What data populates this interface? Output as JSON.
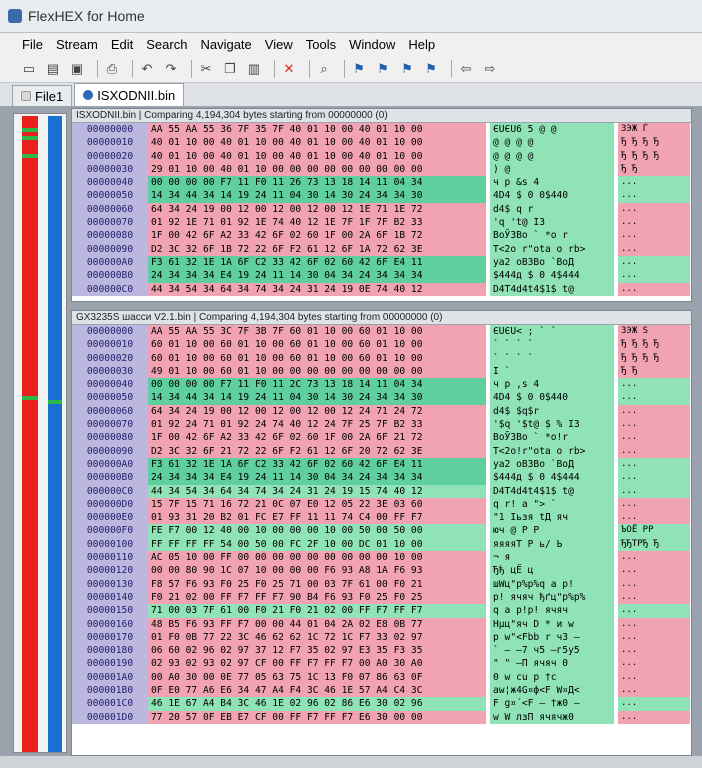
{
  "window_title": "FlexHEX for Home",
  "menu": [
    "File",
    "Stream",
    "Edit",
    "Search",
    "Navigate",
    "View",
    "Tools",
    "Window",
    "Help"
  ],
  "tabs": [
    {
      "label": "File1"
    },
    {
      "label": "ISXODNII.bin"
    }
  ],
  "pane_a": {
    "header": "ISXODNII.bin | Comparing 4,194,304 bytes starting from 00000000 (0)",
    "rows": [
      {
        "addr": "00000000",
        "hex": "AA 55 AA 55 36 7F 35 7F 40 01 10 00 40 01 10 00",
        "txt": "ЄUЄU6 5 @ @",
        "cyr": "ЗЭЖ Ѓ"
      },
      {
        "addr": "00000010",
        "hex": "40 01 10 00 40 01 10 00 40 01 10 00 40 01 10 00",
        "txt": "@ @ @ @",
        "cyr": "Ђ Ђ Ђ Ђ"
      },
      {
        "addr": "00000020",
        "hex": "40 01 10 00 40 01 10 00 40 01 10 00 40 01 10 00",
        "txt": "@ @ @ @",
        "cyr": "Ђ Ђ Ђ Ђ"
      },
      {
        "addr": "00000030",
        "hex": "29 01 10 00 40 01 10 00 00 00 00 00 00 00 00 00",
        "txt": ") @",
        "cyr": "Ђ Ђ"
      },
      {
        "addr": "00000040",
        "hex": "00 00 00 00 F7 11 F0 11 26 73 13 18 14 11 04 34",
        "txt": "ч р &s 4",
        "cyr": "..."
      },
      {
        "addr": "00000050",
        "hex": "14 34 44 34 14 19 24 11 04 30 14 30 24 34 34 30",
        "txt": "4D4 $ 0 0$440",
        "cyr": "..."
      },
      {
        "addr": "00000060",
        "hex": "64 34 24 19 00 12 00 12 00 12 00 12 1E 71 1E 72",
        "txt": "d4$ q r",
        "cyr": "..."
      },
      {
        "addr": "00000070",
        "hex": "01 92 1E 71 01 92 1E 74 40 12 1E 7F 1F 7F B2 33",
        "txt": "'q 't@ I3",
        "cyr": "..."
      },
      {
        "addr": "00000080",
        "hex": "1F 00 42 6F A2 33 42 6F 02 60 1F 00 2A 6F 1B 72",
        "txt": "BoЎ3Bo ` *o r",
        "cyr": "..."
      },
      {
        "addr": "00000090",
        "hex": "D2 3C 32 6F 1B 72 22 6F F2 61 12 6F 1A 72 62 3E",
        "txt": "Т<2o r\"ota o rb>",
        "cyr": "..."
      },
      {
        "addr": "000000A0",
        "hex": "F3 61 32 1E 1A 6F C2 33 42 6F 02 60 42 6F E4 11",
        "txt": "уa2 oВ3Bo `BoД",
        "cyr": "..."
      },
      {
        "addr": "000000B0",
        "hex": "24 34 34 34 E4 19 24 11 14 30 04 34 24 34 34 34",
        "txt": "$444д $ 0 4$444",
        "cyr": "..."
      },
      {
        "addr": "000000C0",
        "hex": "44 34 54 34 64 34 74 34 24 31 24 19 0E 74 40 12",
        "txt": "D4T4d4t4$1$ t@",
        "cyr": "..."
      }
    ]
  },
  "pane_b": {
    "header": "GX3235S шасси V2.1.bin | Comparing 4,194,304 bytes starting from 00000000 (0)",
    "rows": [
      {
        "addr": "00000000",
        "hex": "AA 55 AA 55 3C 7F 3B 7F 60 01 10 00 60 01 10 00",
        "txt": "ЄUЄU< ; ` `",
        "cyr": "ЗЭЖ Ѕ"
      },
      {
        "addr": "00000010",
        "hex": "60 01 10 00 60 01 10 00 60 01 10 00 60 01 10 00",
        "txt": "` ` ` `",
        "cyr": "Ђ Ђ Ђ Ђ"
      },
      {
        "addr": "00000020",
        "hex": "60 01 10 00 60 01 10 00 60 01 10 00 60 01 10 00",
        "txt": "` ` ` `",
        "cyr": "Ђ Ђ Ђ Ђ"
      },
      {
        "addr": "00000030",
        "hex": "49 01 10 00 60 01 10 00 00 00 00 00 00 00 00 00",
        "txt": "I `",
        "cyr": "Ђ Ђ"
      },
      {
        "addr": "00000040",
        "hex": "00 00 00 00 F7 11 F0 11 2C 73 13 18 14 11 04 34",
        "txt": "ч р ,s 4",
        "cyr": "..."
      },
      {
        "addr": "00000050",
        "hex": "14 34 44 34 14 19 24 11 04 30 14 30 24 34 34 30",
        "txt": "4D4 $ 0 0$440",
        "cyr": "..."
      },
      {
        "addr": "00000060",
        "hex": "64 34 24 19 00 12 00 12 00 12 00 12 24 71 24 72",
        "txt": "d4$ $q$r",
        "cyr": "..."
      },
      {
        "addr": "00000070",
        "hex": "01 92 24 71 01 92 24 74 40 12 24 7F 25 7F B2 33",
        "txt": "'$q '$t@ $ % I3",
        "cyr": "..."
      },
      {
        "addr": "00000080",
        "hex": "1F 00 42 6F A2 33 42 6F 02 60 1F 00 2A 6F 21 72",
        "txt": "BoЎ3Bo ` *o!r",
        "cyr": "..."
      },
      {
        "addr": "00000090",
        "hex": "D2 3C 32 6F 21 72 22 6F F2 61 12 6F 20 72 62 3E",
        "txt": "Т<2o!r\"ota o rb>",
        "cyr": "..."
      },
      {
        "addr": "000000A0",
        "hex": "F3 61 32 1E 1A 6F C2 33 42 6F 02 60 42 6F E4 11",
        "txt": "уa2 oВ3Bo `BoД",
        "cyr": "..."
      },
      {
        "addr": "000000B0",
        "hex": "24 34 34 34 E4 19 24 11 14 30 04 34 24 34 34 34",
        "txt": "$444д $ 0 4$444",
        "cyr": "..."
      },
      {
        "addr": "000000C0",
        "hex": "44 34 54 34 64 34 74 34 24 31 24 19 15 74 40 12",
        "txt": "D4T4d4t4$1$ t@",
        "cyr": "..."
      },
      {
        "addr": "000000D0",
        "hex": "15 7F 15 71 16 72 21 0C 07 E0 12 05 22 3E 03 60",
        "txt": "q r! а \"> `",
        "cyr": "..."
      },
      {
        "addr": "000000E0",
        "hex": "01 93 31 20 B2 01 FC E7 FF 11 11 74 C4 00 FF F7",
        "txt": "\"1 Iьзя tД яч",
        "cyr": "..."
      },
      {
        "addr": "000000F0",
        "hex": "FE F7 00 12 40 00 10 00 00 00 10 00 50 00 50 00",
        "txt": "юч @ P P",
        "cyr": "ЪОЁ РР"
      },
      {
        "addr": "00000100",
        "hex": "FF FF FF FF 54 00 50 00 FC 2F 10 00 DC 01 10 00",
        "txt": "яяяяT P ь/ Ь",
        "cyr": "ЂЂТРЂ Ђ"
      },
      {
        "addr": "00000110",
        "hex": "AC 05 10 00 FF 00 00 00 00 00 00 00 00 00 10 00",
        "txt": "¬ я",
        "cyr": "..."
      },
      {
        "addr": "00000120",
        "hex": "00 00 80 90 1C 07 10 00 00 00 F6 93 A8 1A F6 93",
        "txt": "Ђђ цЁ ц",
        "cyr": "..."
      },
      {
        "addr": "00000130",
        "hex": "F8 57 F6 93 F0 25 F0 25 71 00 03 7F 61 00 F0 21",
        "txt": "шWц\"р%р%q a р!",
        "cyr": "..."
      },
      {
        "addr": "00000140",
        "hex": "F0 21 02 00 FF F7 FF F7 90 B4 F6 93 F0 25 F0 25",
        "txt": "р! ячяч ђґц\"р%р%",
        "cyr": "..."
      },
      {
        "addr": "00000150",
        "hex": "71 00 03 7F 61 00 F0 21 F0 21 02 00 FF F7 FF F7",
        "txt": "q a р!р! ячяч",
        "cyr": "..."
      },
      {
        "addr": "00000160",
        "hex": "48 B5 F6 93 FF F7 00 00 44 01 04 2A 02 E8 0B 77",
        "txt": "Hµц\"яч D * и w",
        "cyr": "..."
      },
      {
        "addr": "00000170",
        "hex": "01 F0 0B 77 22 3C 46 62 62 1C 72 1C F7 33 02 97",
        "txt": "р w\"<Fbb r ч3 —",
        "cyr": "..."
      },
      {
        "addr": "00000180",
        "hex": "06 60 02 96 02 97 37 12 F7 35 02 97 E3 35 F3 35",
        "txt": "` – —7 ч5 —г5у5",
        "cyr": "..."
      },
      {
        "addr": "00000190",
        "hex": "02 93 02 93 02 97 CF 00 FF F7 FF F7 00 A0 30 A0",
        "txt": "\" \" —П ячяч 0",
        "cyr": "..."
      },
      {
        "addr": "000001A0",
        "hex": "00 A0 30 00 0E 77 05 63 75 1C 13 F0 07 86 63 0F",
        "txt": "0 w cu р †c",
        "cyr": "..."
      },
      {
        "addr": "000001B0",
        "hex": "0F E0 77 A6 E6 34 47 A4 F4 3C 46 1E 57 A4 C4 3C",
        "txt": "аw¦ж4G¤ф<F W¤Д<",
        "cyr": "..."
      },
      {
        "addr": "000001C0",
        "hex": "46 1E 67 A4 B4 3C 46 1E 02 96 02 86 E6 30 02 96",
        "txt": "F g¤´<F – †ж0 –",
        "cyr": "..."
      },
      {
        "addr": "000001D0",
        "hex": "77 20 57 0F EB E7 CF 00 FF F7 FF F7 E6 30 00 00",
        "txt": "w W лзП ячячж0",
        "cyr": "..."
      }
    ]
  },
  "colors": {
    "diff": "#f2a3b3",
    "same": "#8fe3b7",
    "address": "#bcb7df",
    "overview_a": "#e8211d",
    "overview_b": "#1b6fd0"
  }
}
